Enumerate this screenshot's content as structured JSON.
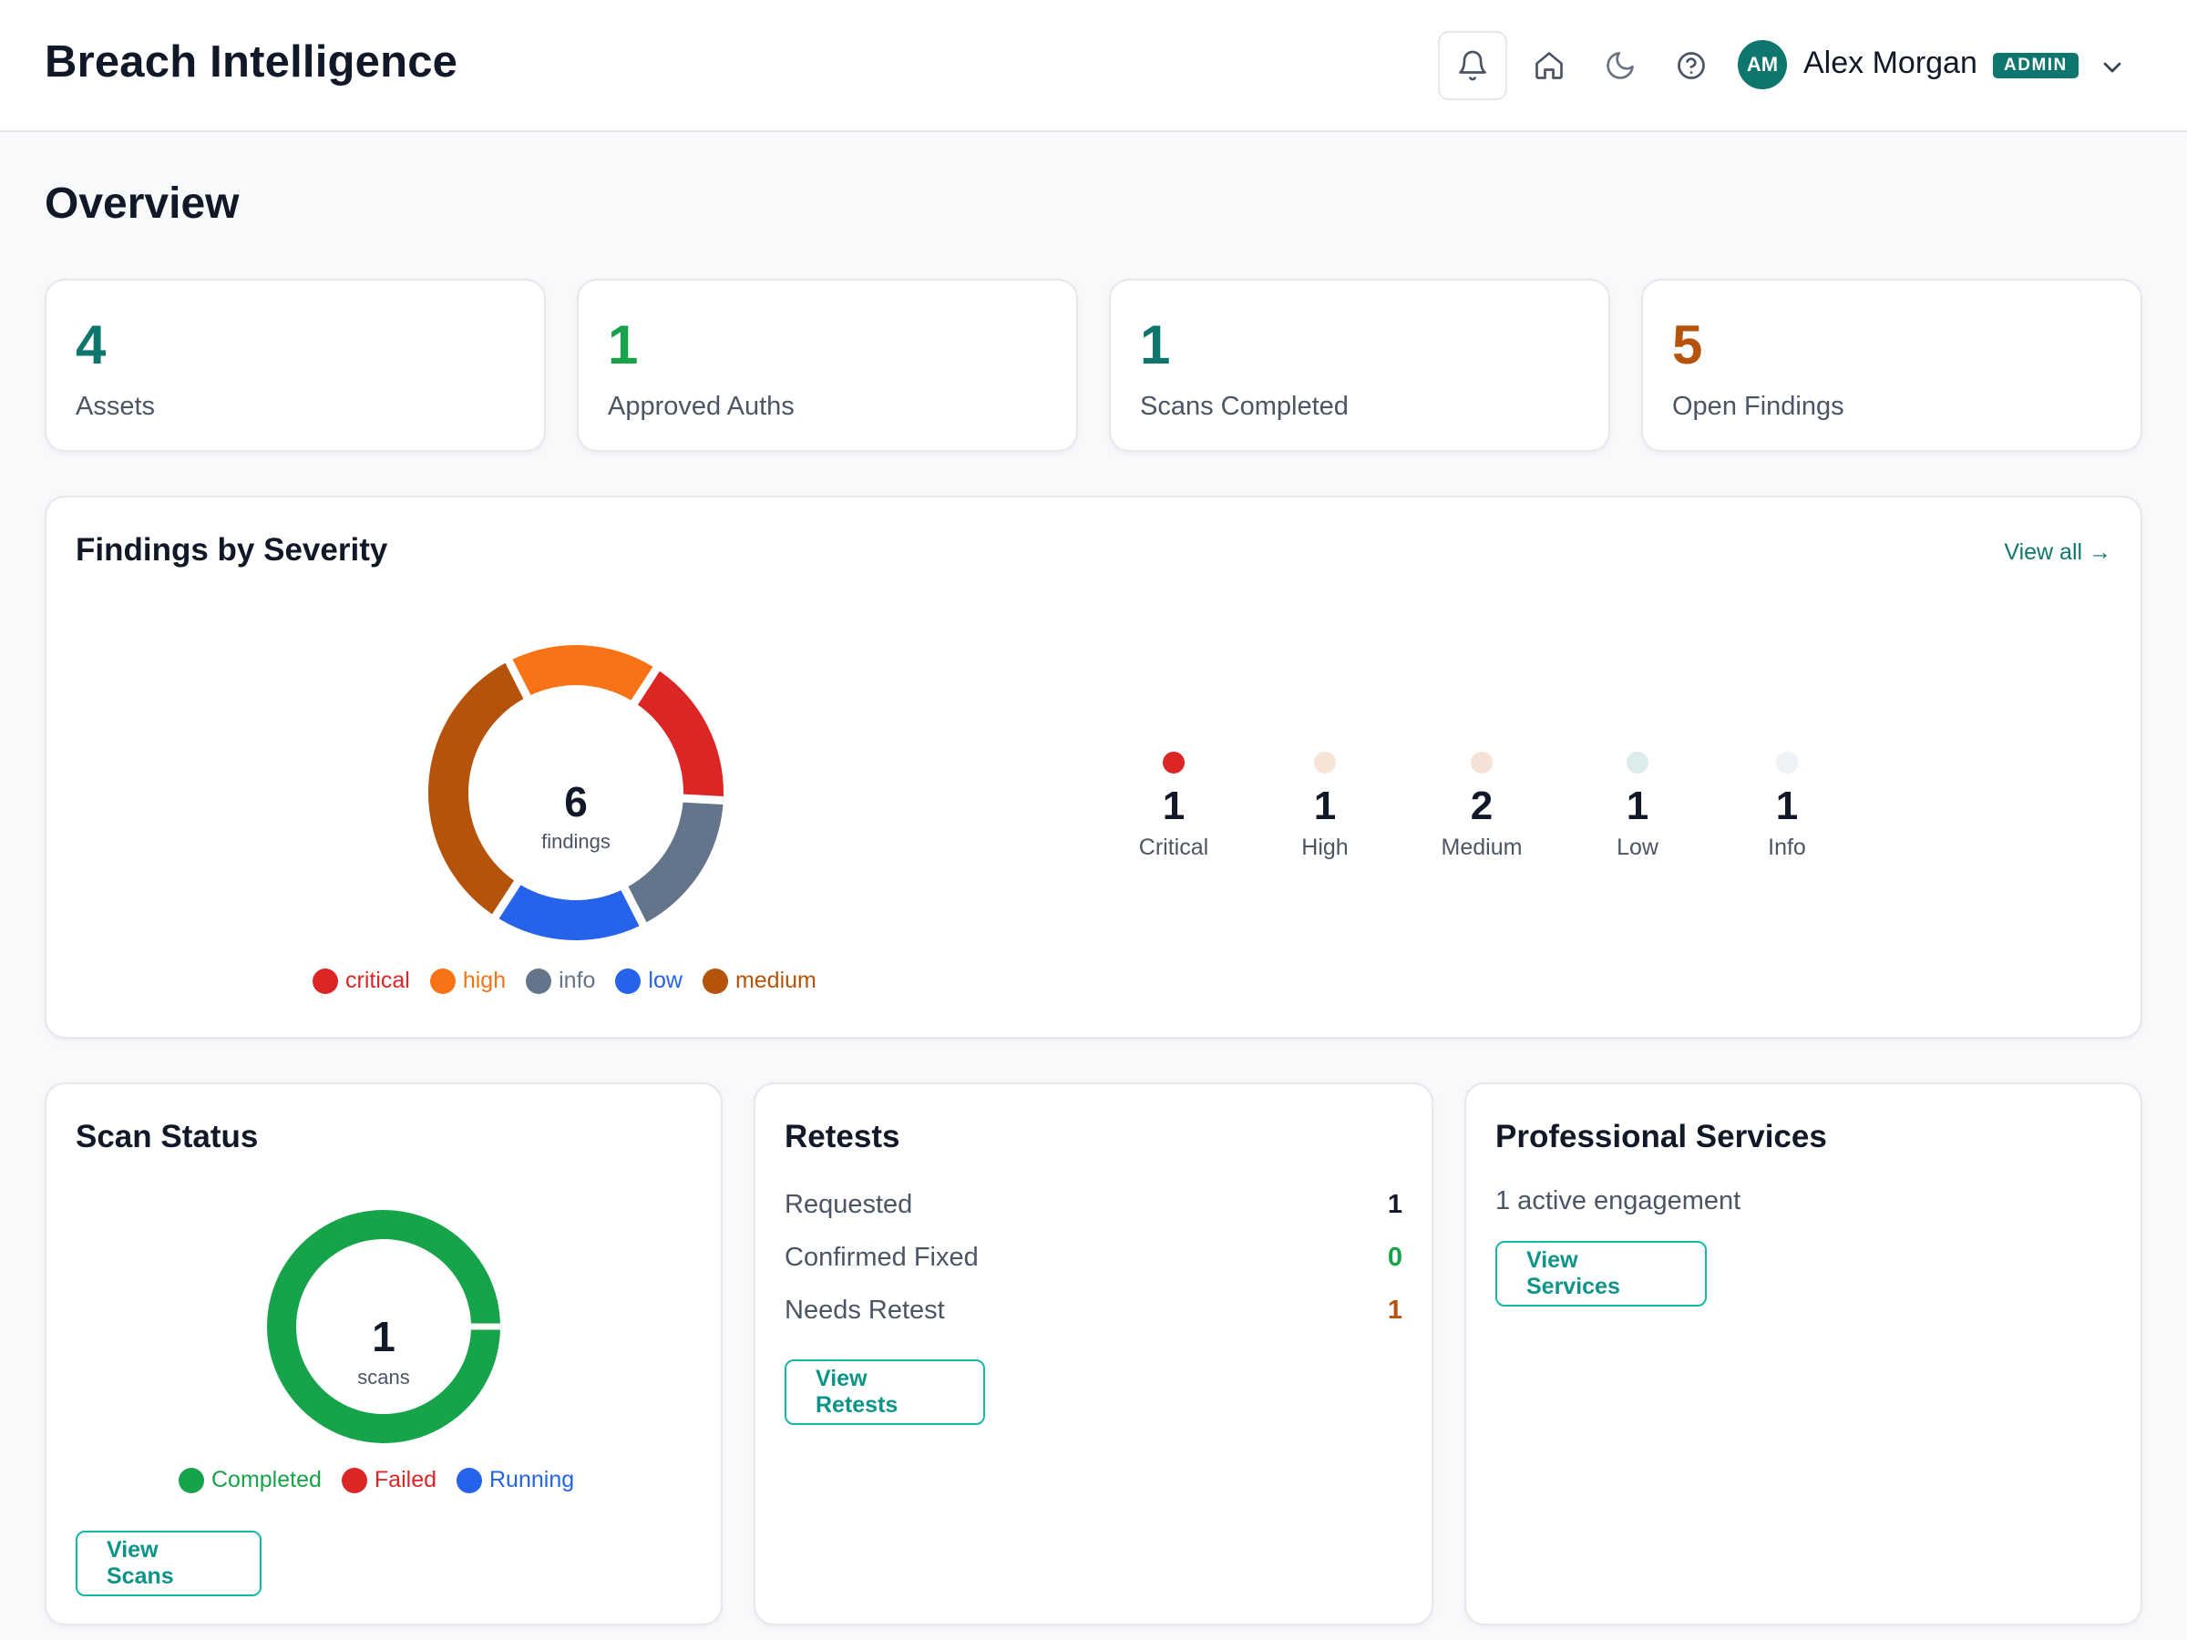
{
  "header": {
    "app_title": "Breach Intelligence",
    "icons": [
      "bell-icon",
      "home-icon",
      "moon-icon",
      "help-icon"
    ],
    "user": {
      "initials": "AM",
      "name": "Alex Morgan",
      "role": "ADMIN"
    }
  },
  "page": {
    "title": "Overview"
  },
  "stats": [
    {
      "value": "4",
      "label": "Assets",
      "color": "#0f766e"
    },
    {
      "value": "1",
      "label": "Approved Auths",
      "color": "#16a34a"
    },
    {
      "value": "1",
      "label": "Scans Completed",
      "color": "#0f766e"
    },
    {
      "value": "5",
      "label": "Open Findings",
      "color": "#b45309"
    }
  ],
  "findings": {
    "title": "Findings by Severity",
    "view_all": "View all →",
    "total": "6",
    "total_label": "findings",
    "legend": [
      {
        "label": "critical",
        "color": "#dc2626"
      },
      {
        "label": "high",
        "color": "#f97316"
      },
      {
        "label": "info",
        "color": "#64748b"
      },
      {
        "label": "low",
        "color": "#2563eb"
      },
      {
        "label": "medium",
        "color": "#b45309"
      }
    ],
    "tiles": [
      {
        "count": "1",
        "label": "Critical",
        "dot": "#dc2626"
      },
      {
        "count": "1",
        "label": "High",
        "dot": "#f7e4d6"
      },
      {
        "count": "2",
        "label": "Medium",
        "dot": "#f5e2d6"
      },
      {
        "count": "1",
        "label": "Low",
        "dot": "#dbeceb"
      },
      {
        "count": "1",
        "label": "Info",
        "dot": "#eef1f6"
      }
    ]
  },
  "scan_status": {
    "title": "Scan Status",
    "total": "1",
    "total_label": "scans",
    "legend": [
      {
        "label": "Completed",
        "color": "#16a34a"
      },
      {
        "label": "Failed",
        "color": "#dc2626"
      },
      {
        "label": "Running",
        "color": "#2563eb"
      }
    ],
    "button": "View Scans"
  },
  "retests": {
    "title": "Retests",
    "rows": [
      {
        "label": "Requested",
        "value": "1",
        "color": "#111827"
      },
      {
        "label": "Confirmed Fixed",
        "value": "0",
        "color": "#16a34a"
      },
      {
        "label": "Needs Retest",
        "value": "1",
        "color": "#b45309"
      }
    ],
    "button": "View Retests"
  },
  "services": {
    "title": "Professional Services",
    "subtitle": "1 active engagement",
    "button": "View Services"
  },
  "chart_data": [
    {
      "type": "pie",
      "title": "Findings by Severity",
      "categories": [
        "critical",
        "high",
        "info",
        "low",
        "medium"
      ],
      "values": [
        1,
        1,
        1,
        1,
        2
      ],
      "colors": [
        "#dc2626",
        "#f97316",
        "#64748b",
        "#2563eb",
        "#b45309"
      ]
    },
    {
      "type": "pie",
      "title": "Scan Status",
      "categories": [
        "Completed",
        "Failed",
        "Running"
      ],
      "values": [
        1,
        0,
        0
      ],
      "colors": [
        "#16a34a",
        "#dc2626",
        "#2563eb"
      ]
    }
  ]
}
